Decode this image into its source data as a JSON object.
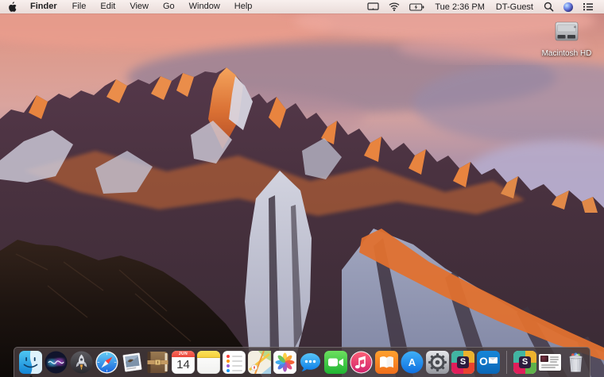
{
  "menu_bar": {
    "apple_menu_label": "Apple",
    "active_app": "Finder",
    "menus": [
      "File",
      "Edit",
      "View",
      "Go",
      "Window",
      "Help"
    ],
    "status": {
      "time": "Tue 2:36 PM",
      "user": "DT-Guest"
    },
    "status_icons": [
      "display-mirroring",
      "wifi",
      "battery",
      "spotlight",
      "siri",
      "notification-center"
    ]
  },
  "desktop": {
    "wallpaper_name": "macOS Sierra mountain sunset (Lone Pine Peak)",
    "icons": [
      {
        "label": "Macintosh HD",
        "icon": "hard-drive-icon"
      }
    ]
  },
  "dock": {
    "apps": [
      {
        "name": "Finder",
        "icon": "finder-icon",
        "running": true
      },
      {
        "name": "Siri",
        "icon": "siri-icon"
      },
      {
        "name": "Launchpad",
        "icon": "launchpad-icon"
      },
      {
        "name": "Safari",
        "icon": "safari-icon"
      },
      {
        "name": "Mail",
        "icon": "mail-stamp-icon"
      },
      {
        "name": "Contacts",
        "icon": "contacts-icon"
      },
      {
        "name": "Calendar",
        "icon": "calendar-icon",
        "badge_month": "JUN",
        "badge_day": "14"
      },
      {
        "name": "Notes",
        "icon": "notes-icon"
      },
      {
        "name": "Reminders",
        "icon": "reminders-icon"
      },
      {
        "name": "Maps",
        "icon": "maps-icon"
      },
      {
        "name": "Photos",
        "icon": "photos-icon"
      },
      {
        "name": "Messages",
        "icon": "messages-icon"
      },
      {
        "name": "FaceTime",
        "icon": "facetime-icon"
      },
      {
        "name": "iTunes",
        "icon": "itunes-icon"
      },
      {
        "name": "iBooks",
        "icon": "ibooks-icon"
      },
      {
        "name": "App Store",
        "icon": "app-store-icon",
        "letter": "A"
      },
      {
        "name": "System Preferences",
        "icon": "system-preferences-icon"
      },
      {
        "name": "Slack",
        "icon": "slack-icon",
        "letter": "S"
      },
      {
        "name": "Outlook",
        "icon": "outlook-icon",
        "letter": "O"
      }
    ],
    "others": [
      {
        "name": "Slack file",
        "icon": "slack-file-icon",
        "letter": "S"
      },
      {
        "name": "Document",
        "icon": "document-file-icon"
      },
      {
        "name": "Trash (full)",
        "icon": "trash-full-icon"
      }
    ]
  },
  "colors": {
    "menu_bar_bg": "#f3eae8",
    "menu_text": "#1d1d1f",
    "dock_bg": "rgba(68,58,60,0.85)",
    "sky_pink": "#e09a8c",
    "sky_lavender": "#b3abcd",
    "sunlit_rock": "#d96f33",
    "shadow_rock": "#43303c"
  }
}
